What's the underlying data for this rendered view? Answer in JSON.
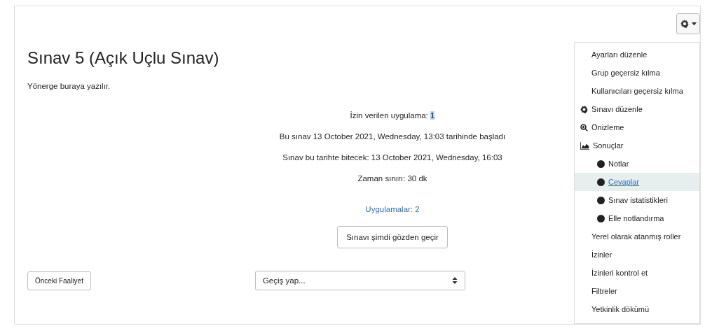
{
  "page": {
    "title": "Sınav 5 (Açık Uçlu Sınav)",
    "intro": "Yönerge buraya yazılır.",
    "allowed": {
      "label": "İzin verilen uygulama:",
      "value": "1",
      "highlighted": true
    },
    "info_lines": [
      "Bu sınav 13 October 2021, Wednesday, 13:03 tarihinde başladı",
      "Sınav bu tarihte bitecek: 13 October 2021, Wednesday, 16:03",
      "Zaman sınırı: 30 dk"
    ],
    "attempts_link": "Uygulamalar: 2",
    "review_button": "Sınavı şimdi gözden geçir",
    "prev_button": "Önceki Faaliyet",
    "jump_select": {
      "value": "Geçiş yap..."
    }
  },
  "menu": {
    "expanded": true,
    "items": [
      {
        "label": "Ayarları düzenle",
        "kind": "plain",
        "selected": false
      },
      {
        "label": "Grup geçersiz kılma",
        "kind": "plain",
        "selected": false
      },
      {
        "label": "Kullanıcıları geçersiz kılma",
        "kind": "plain",
        "selected": false
      },
      {
        "label": "Sınavı düzenle",
        "kind": "gear",
        "selected": false
      },
      {
        "label": "Önizleme",
        "kind": "zoom",
        "selected": false
      },
      {
        "label": "Sonuçlar",
        "kind": "chart",
        "selected": false,
        "children": [
          {
            "label": "Notlar",
            "selected": false
          },
          {
            "label": "Cevaplar",
            "selected": true
          },
          {
            "label": "Sınav istatistikleri",
            "selected": false
          },
          {
            "label": "Elle notlandırma",
            "selected": false
          }
        ]
      },
      {
        "label": "Yerel olarak atanmış roller",
        "kind": "plain",
        "selected": false
      },
      {
        "label": "İzinler",
        "kind": "plain",
        "selected": false
      },
      {
        "label": "İzinleri kontrol et",
        "kind": "plain",
        "selected": false
      },
      {
        "label": "Filtreler",
        "kind": "plain",
        "selected": false
      },
      {
        "label": "Yetkinlik dökümü",
        "kind": "plain",
        "selected": false
      }
    ]
  }
}
